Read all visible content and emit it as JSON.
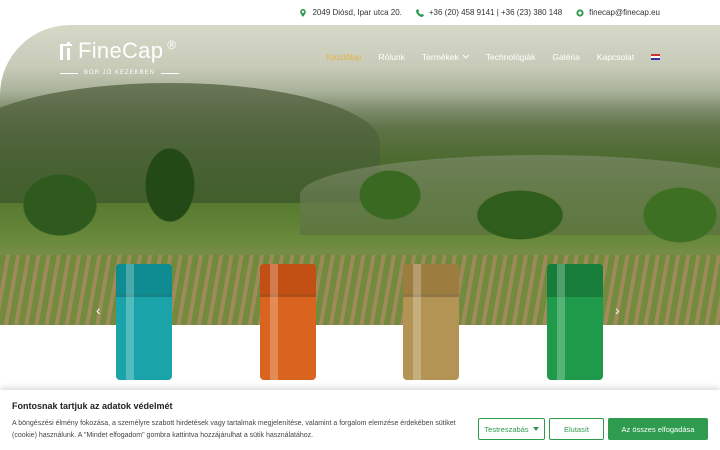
{
  "topbar": {
    "address": "2049 Diósd, Ipar utca 20.",
    "phone": "+36 (20) 458 9141 | +36 (23) 380 148",
    "email": "finecap@finecap.eu"
  },
  "logo": {
    "name": "FineCap",
    "reg": "®",
    "tagline": "BOR JÓ KEZEKBEN"
  },
  "nav": [
    "Kezdőlap",
    "Rólunk",
    "Termékek",
    "Technológiák",
    "Galéria",
    "Kapcsolat"
  ],
  "slider": {
    "prev": "‹",
    "next": "›"
  },
  "caps": [
    {
      "color": "#1aa3a8",
      "top": "#0f8c92"
    },
    {
      "color": "#d9641f",
      "top": "#c24f14"
    },
    {
      "color": "#b39455",
      "top": "#9c7d3f"
    },
    {
      "color": "#1e9a4a",
      "top": "#167e3a"
    }
  ],
  "cookie": {
    "title": "Fontosnak tartjuk az adatok védelmét",
    "text": "A böngészési élmény fokozása, a személyre szabott hirdetések vagy tartalmak megjelenítése, valamint a forgalom elemzése érdekében sütiket (cookie) használunk. A \"Mindet elfogadom\" gombra kattintva hozzájárulhat a sütik használatához.",
    "customize": "Testreszabás",
    "reject": "Elutasít",
    "accept_all": "Az összes elfogadása"
  },
  "colors": {
    "accent": "#2e9b4e",
    "nav_active": "#e6b34a"
  }
}
